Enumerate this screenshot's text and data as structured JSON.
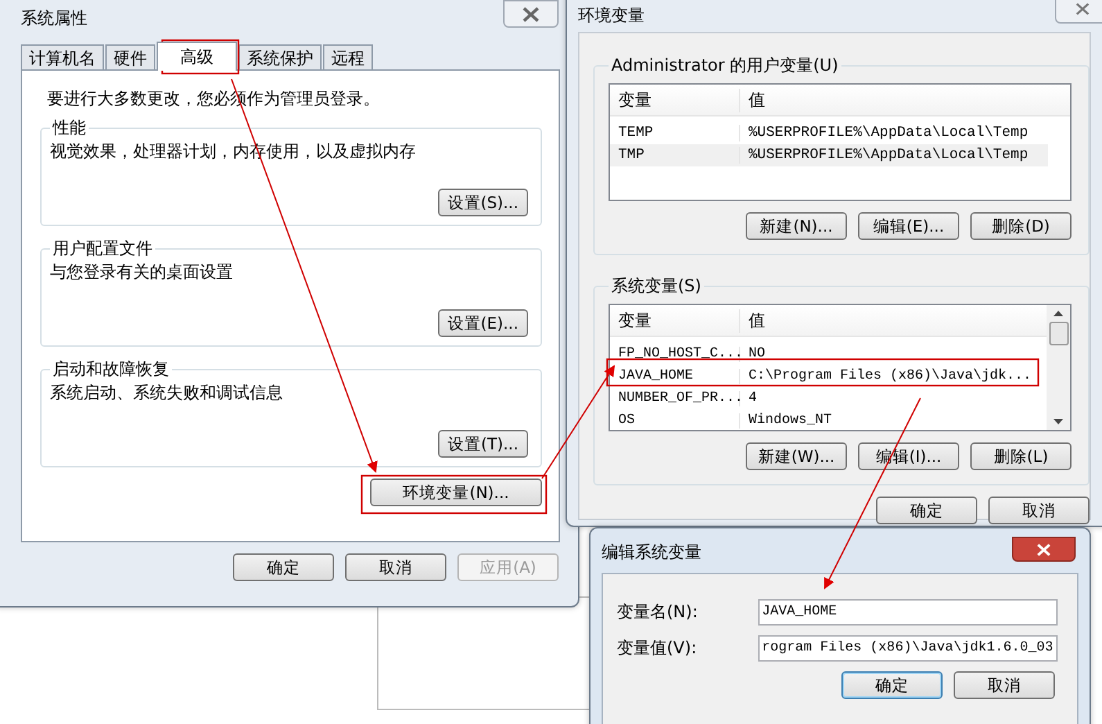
{
  "system_properties": {
    "title": "系统属性",
    "tabs": [
      {
        "label": "计算机名",
        "selected": false
      },
      {
        "label": "硬件",
        "selected": false
      },
      {
        "label": "高级",
        "selected": true
      },
      {
        "label": "系统保护",
        "selected": false
      },
      {
        "label": "远程",
        "selected": false
      }
    ],
    "note": "要进行大多数更改，您必须作为管理员登录。",
    "groups": [
      {
        "title": "性能",
        "description": "视觉效果，处理器计划，内存使用，以及虚拟内存",
        "button": "设置(S)..."
      },
      {
        "title": "用户配置文件",
        "description": "与您登录有关的桌面设置",
        "button": "设置(E)..."
      },
      {
        "title": "启动和故障恢复",
        "description": "系统启动、系统失败和调试信息",
        "button": "设置(T)..."
      }
    ],
    "env_button": "环境变量(N)...",
    "buttons": [
      {
        "label": "确定",
        "disabled": false
      },
      {
        "label": "取消",
        "disabled": false
      },
      {
        "label": "应用(A)",
        "disabled": true
      }
    ]
  },
  "environment_variables": {
    "title": "环境变量",
    "user_group": {
      "title": "Administrator 的用户变量(U)",
      "columns": [
        "变量",
        "值"
      ],
      "rows": [
        {
          "name": "TEMP",
          "value": "%USERPROFILE%\\AppData\\Local\\Temp"
        },
        {
          "name": "TMP",
          "value": "%USERPROFILE%\\AppData\\Local\\Temp"
        }
      ],
      "buttons": [
        "新建(N)...",
        "编辑(E)...",
        "删除(D)"
      ]
    },
    "system_group": {
      "title": "系统变量(S)",
      "columns": [
        "变量",
        "值"
      ],
      "rows": [
        {
          "name": "FP_NO_HOST_C...",
          "value": "NO"
        },
        {
          "name": "JAVA_HOME",
          "value": "C:\\Program Files (x86)\\Java\\jdk..."
        },
        {
          "name": "NUMBER_OF_PR...",
          "value": "4"
        },
        {
          "name": "OS",
          "value": "Windows_NT"
        }
      ],
      "buttons": [
        "新建(W)...",
        "编辑(I)...",
        "删除(L)"
      ]
    },
    "buttons": [
      "确定",
      "取消"
    ]
  },
  "edit_system_variable": {
    "title": "编辑系统变量",
    "fields": [
      {
        "label": "变量名(N):",
        "value": "JAVA_HOME"
      },
      {
        "label": "变量值(V):",
        "value": "rogram Files (x86)\\Java\\jdk1.6.0_03"
      }
    ],
    "buttons": [
      {
        "label": "确定",
        "focused": true
      },
      {
        "label": "取消",
        "focused": false
      }
    ]
  }
}
